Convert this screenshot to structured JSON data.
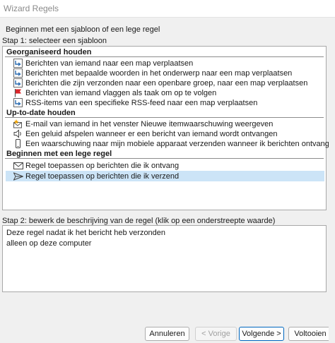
{
  "window": {
    "title": "Wizard Regels"
  },
  "intro": "Beginnen met een sjabloon of een lege regel",
  "step1": {
    "label": "Stap 1: selecteer een sjabloon"
  },
  "groups": [
    {
      "title": "Georganiseerd houden"
    },
    {
      "title": "Up-to-date houden"
    },
    {
      "title": "Beginnen met een lege regel"
    }
  ],
  "items": [
    {
      "label": "Berichten van iemand naar een map verplaatsen",
      "icon": "move-to-folder-icon"
    },
    {
      "label": "Berichten met bepaalde woorden in het onderwerp naar een map verplaatsen",
      "icon": "move-to-folder-icon"
    },
    {
      "label": "Berichten die zijn verzonden naar een openbare groep, naar een map verplaatsen",
      "icon": "move-to-folder-icon"
    },
    {
      "label": "Berichten van iemand vlaggen als taak om op te volgen",
      "icon": "red-flag-icon"
    },
    {
      "label": "RSS-items van een specifieke RSS-feed naar een map verplaatsen",
      "icon": "move-to-folder-icon"
    },
    {
      "label": "E-mail van iemand in het venster Nieuwe itemwaarschuwing weergeven",
      "icon": "alert-envelope-icon"
    },
    {
      "label": "Een geluid afspelen wanneer er een bericht van iemand wordt ontvangen",
      "icon": "speaker-icon"
    },
    {
      "label": "Een waarschuwing naar mijn mobiele apparaat verzenden wanneer ik berichten ontvang",
      "icon": "mobile-phone-icon"
    },
    {
      "label": "Regel toepassen op berichten die ik ontvang",
      "icon": "envelope-icon"
    },
    {
      "label": "Regel toepassen op berichten die ik verzend",
      "icon": "send-icon",
      "selected": true
    }
  ],
  "step2": {
    "label": "Stap 2: bewerk de beschrijving van de regel (klik op een onderstreepte waarde)"
  },
  "description": [
    "Deze regel nadat ik het bericht heb verzonden",
    "alleen op deze computer"
  ],
  "buttons": {
    "cancel": "Annuleren",
    "back": "< Vorige",
    "next": "Volgende >",
    "finish": "Voltooien"
  }
}
